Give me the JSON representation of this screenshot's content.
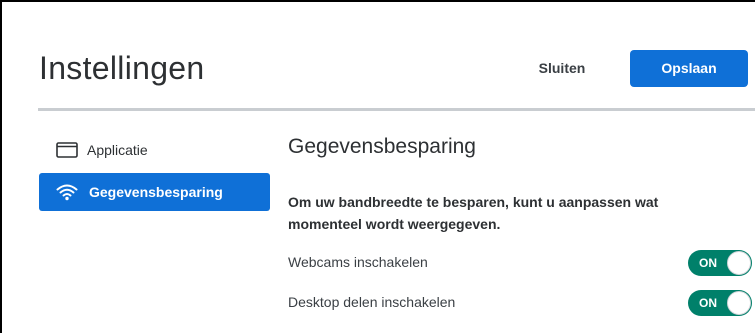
{
  "header": {
    "title": "Instellingen",
    "close_label": "Sluiten",
    "save_label": "Opslaan"
  },
  "sidebar": {
    "items": [
      {
        "label": "Applicatie",
        "icon": "window-icon",
        "active": false
      },
      {
        "label": "Gegevensbesparing",
        "icon": "wifi-icon",
        "active": true
      }
    ]
  },
  "main": {
    "section_title": "Gegevensbesparing",
    "description": "Om uw bandbreedte te besparen, kunt u aanpassen wat momenteel wordt weergegeven.",
    "settings": [
      {
        "label": "Webcams inschakelen",
        "state": "ON",
        "enabled": true
      },
      {
        "label": "Desktop delen inschakelen",
        "state": "ON",
        "enabled": true
      }
    ]
  },
  "colors": {
    "accent": "#0f70d7",
    "toggle_on": "#00806a",
    "divider": "#c9cdd1",
    "text": "#2d3033"
  }
}
